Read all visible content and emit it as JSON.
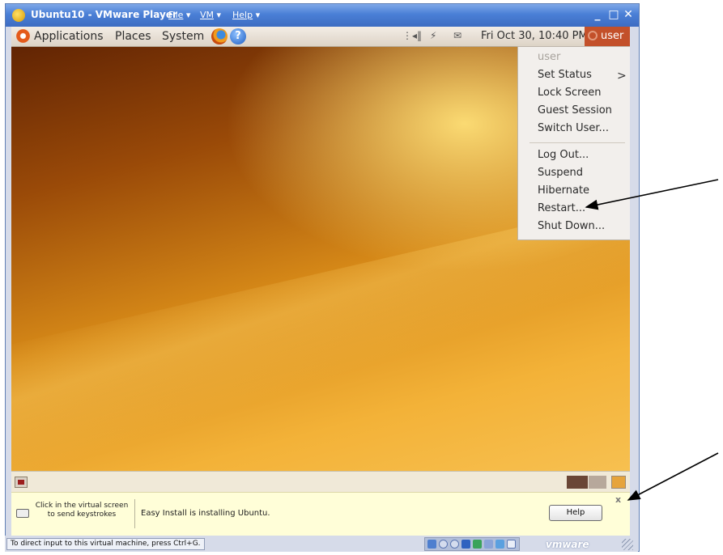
{
  "window": {
    "title": "Ubuntu10 - VMware Player",
    "menus": [
      "File",
      "VM",
      "Help"
    ],
    "minimize": "_",
    "maximize": "□",
    "close": "✕"
  },
  "guest_panel": {
    "applications": "Applications",
    "places": "Places",
    "system": "System",
    "datetime": "Fri Oct 30, 10:40 PM",
    "user": "user"
  },
  "user_menu": {
    "header": "user",
    "items_top": [
      "Set Status",
      "Lock Screen",
      "Guest Session",
      "Switch User..."
    ],
    "items_bottom": [
      "Log Out...",
      "Suspend",
      "Hibernate",
      "Restart...",
      "Shut Down..."
    ],
    "submenu_chevron": ">"
  },
  "info_bar": {
    "hint": "Click in the virtual screen to send keystrokes",
    "message": "Easy Install is installing Ubuntu.",
    "help_label": "Help",
    "close_label": "x"
  },
  "status_bar": {
    "text": "To direct input to this virtual machine, press Ctrl+G.",
    "brand": "vmware"
  },
  "colors": {
    "title_blue": "#3d6cc2",
    "panel_bg": "#ddd3c6",
    "user_button": "#c3502a",
    "infobar_bg": "#fffed8"
  }
}
